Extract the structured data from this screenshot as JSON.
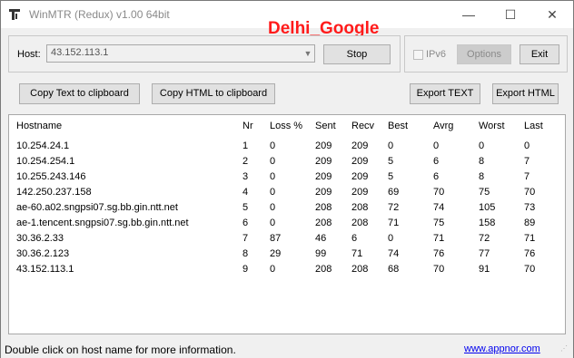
{
  "title_bar": {
    "title": "WinMTR (Redux) v1.00 64bit",
    "overlay_text": "Delhi_Google",
    "overlay_color": "#ff1b1b",
    "icons": {
      "app": "app-icon",
      "minimize": "minimize-icon",
      "maximize": "maximize-icon",
      "close": "close-icon"
    }
  },
  "host_panel": {
    "host_label": "Host:",
    "host_value": "43.152.113.1",
    "stop_label": "Stop"
  },
  "options_panel": {
    "ipv6_label": "IPv6",
    "ipv6_checked": false,
    "options_label": "Options",
    "exit_label": "Exit"
  },
  "export_bar": {
    "copy_text_label": "Copy Text to clipboard",
    "copy_html_label": "Copy HTML to clipboard",
    "export_text_label": "Export TEXT",
    "export_html_label": "Export HTML"
  },
  "results": {
    "columns": [
      "Hostname",
      "Nr",
      "Loss %",
      "Sent",
      "Recv",
      "Best",
      "Avrg",
      "Worst",
      "Last"
    ],
    "rows": [
      [
        "10.254.24.1",
        "1",
        "0",
        "209",
        "209",
        "0",
        "0",
        "0",
        "0"
      ],
      [
        "10.254.254.1",
        "2",
        "0",
        "209",
        "209",
        "5",
        "6",
        "8",
        "7"
      ],
      [
        "10.255.243.146",
        "3",
        "0",
        "209",
        "209",
        "5",
        "6",
        "8",
        "7"
      ],
      [
        "142.250.237.158",
        "4",
        "0",
        "209",
        "209",
        "69",
        "70",
        "75",
        "70"
      ],
      [
        "ae-60.a02.sngpsi07.sg.bb.gin.ntt.net",
        "5",
        "0",
        "208",
        "208",
        "72",
        "74",
        "105",
        "73"
      ],
      [
        "ae-1.tencent.sngpsi07.sg.bb.gin.ntt.net",
        "6",
        "0",
        "208",
        "208",
        "71",
        "75",
        "158",
        "89"
      ],
      [
        "30.36.2.33",
        "7",
        "87",
        "46",
        "6",
        "0",
        "71",
        "72",
        "71"
      ],
      [
        "30.36.2.123",
        "8",
        "29",
        "99",
        "71",
        "74",
        "76",
        "77",
        "76"
      ],
      [
        "43.152.113.1",
        "9",
        "0",
        "208",
        "208",
        "68",
        "70",
        "91",
        "70"
      ]
    ]
  },
  "status_bar": {
    "message": "Double click on host name for more information.",
    "link_text": "www.appnor.com"
  }
}
